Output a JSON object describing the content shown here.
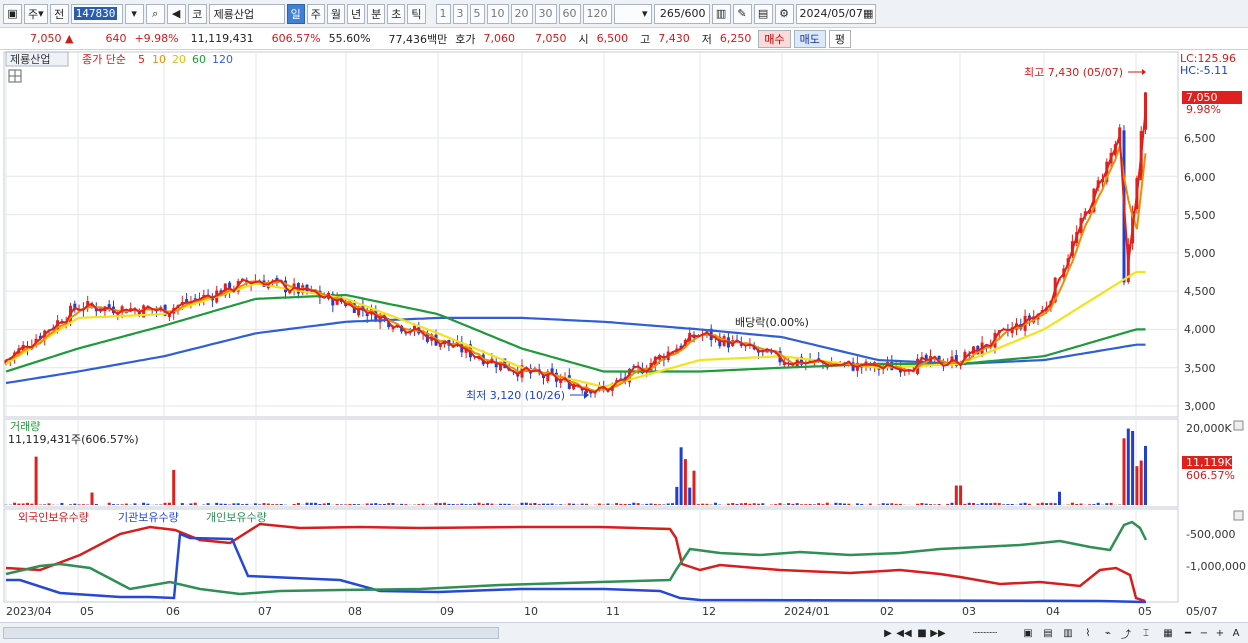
{
  "toolbar": {
    "market": "주",
    "prev_label": "전",
    "code": "147830",
    "kind": "코",
    "name": "제룡산업",
    "periods": [
      "일",
      "주",
      "월",
      "년",
      "분",
      "초",
      "틱"
    ],
    "active_period": "일",
    "intervals": [
      "1",
      "3",
      "5",
      "10",
      "20",
      "30",
      "60",
      "120"
    ],
    "count": "265",
    "total": "/600",
    "date": "2024/05/07"
  },
  "quote": {
    "price": "7,050",
    "arrow": "▲",
    "change": "640",
    "change_pct": "+9.98%",
    "volume": "11,119,431",
    "volume_ratio": "606.57%",
    "turnover": "55.60%",
    "amount": "77,436백만",
    "ask_label": "호가",
    "ask1": "7,060",
    "ask2": "7,050",
    "open_label": "시",
    "open": "6,500",
    "high_label": "고",
    "high": "7,430",
    "low_label": "저",
    "low": "6,250",
    "buy_label": "매수",
    "sell_label": "매도",
    "eval_label": "평"
  },
  "price_pane": {
    "stock_label": "제룡산업",
    "ma_label": "종가 단순",
    "ma_periods": [
      "5",
      "10",
      "20",
      "60",
      "120"
    ],
    "lc": "LC:125.96",
    "hc": "HC:-5.11",
    "cur_price": "7,050",
    "cur_pct": "9.98%",
    "y_ticks": [
      "3,000",
      "3,500",
      "4,000",
      "4,500",
      "5,000",
      "5,500",
      "6,000",
      "6,500"
    ],
    "high_note": "최고 7,430 (05/07)",
    "low_note": "최저 3,120 (10/26)",
    "div_note": "배당락(0.00%)"
  },
  "volume_pane": {
    "title": "거래량",
    "info": "11,119,431주(606.57%)",
    "y_tick": "20,000K",
    "cur": "11,119K",
    "cur_pct": "606.57%"
  },
  "holding_pane": {
    "labels": [
      "외국인보유수량",
      "기관보유수량",
      "개인보유수량"
    ],
    "y_ticks": [
      "-500,000",
      "-1,000,000"
    ]
  },
  "x_axis": [
    "2023/04",
    "05",
    "06",
    "07",
    "08",
    "09",
    "10",
    "11",
    "12",
    "2024/01",
    "02",
    "03",
    "04",
    "05"
  ],
  "x_right": "05/07",
  "colors": {
    "up": "#e0201c",
    "down": "#1f3fd1",
    "ma5": "#e0201c",
    "ma10": "#f08c00",
    "ma20": "#f4e21a",
    "ma60": "#1e9a3a",
    "ma120": "#2f5fd6",
    "foreign": "#d81d1d",
    "institution": "#2548d6",
    "individual": "#2f8f55"
  },
  "chart_data": {
    "type": "line",
    "title": "제룡산업",
    "x": [
      "2023/04",
      "05",
      "06",
      "07",
      "08",
      "09",
      "10",
      "11",
      "12",
      "2024/01",
      "02",
      "03",
      "04",
      "05"
    ],
    "series": [
      {
        "name": "종가",
        "values": [
          3600,
          4300,
          4250,
          4650,
          4350,
          3850,
          3450,
          3200,
          3950,
          3600,
          3500,
          3600,
          4250,
          7050
        ]
      },
      {
        "name": "20",
        "values": [
          3550,
          4150,
          4200,
          4600,
          4400,
          3950,
          3500,
          3250,
          3600,
          3650,
          3500,
          3550,
          4000,
          4750
        ]
      },
      {
        "name": "60",
        "values": [
          3450,
          3750,
          4050,
          4400,
          4450,
          4200,
          3750,
          3450,
          3450,
          3500,
          3550,
          3550,
          3650,
          4000
        ]
      },
      {
        "name": "120",
        "values": [
          3300,
          3450,
          3650,
          3950,
          4100,
          4150,
          4150,
          4100,
          4000,
          3900,
          3600,
          3550,
          3600,
          3800
        ]
      }
    ],
    "ylim": [
      2950,
      7500
    ]
  }
}
